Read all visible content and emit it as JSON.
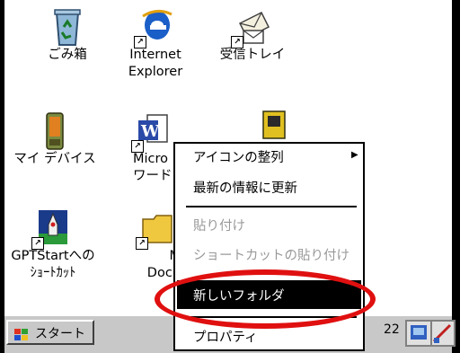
{
  "desktop": {
    "icons": [
      {
        "label1": "ごみ箱",
        "label2": "",
        "icon": "recycle-bin-icon"
      },
      {
        "label1": "Internet",
        "label2": "Explorer",
        "icon": "internet-explorer-icon"
      },
      {
        "label1": "受信トレイ",
        "label2": "",
        "icon": "inbox-icon"
      },
      {
        "label1": "マイ デバイス",
        "label2": "",
        "icon": "my-device-icon"
      },
      {
        "label1": "Micro",
        "label2": "ワード",
        "icon": "word-icon"
      },
      {
        "label1": "GPTStartへの",
        "label2": "ｼｮｰﾄｶｯﾄ",
        "icon": "gptstart-shortcut-icon"
      },
      {
        "label1": "M",
        "label2": "Docu",
        "icon": "my-documents-icon"
      }
    ]
  },
  "context_menu": {
    "items": [
      {
        "label": "アイコンの整列",
        "enabled": true,
        "submenu": true
      },
      {
        "label": "最新の情報に更新",
        "enabled": true
      },
      {
        "label": "貼り付け",
        "enabled": false
      },
      {
        "label": "ショートカットの貼り付け",
        "enabled": false
      },
      {
        "label": "新しいフォルダ",
        "enabled": true,
        "highlighted": true
      },
      {
        "label": "プロパティ",
        "enabled": true
      }
    ],
    "submenu_arrow": "▶"
  },
  "taskbar": {
    "start_label": "スタート",
    "clock": "22"
  },
  "annotation": {
    "ring_color": "#e01010"
  }
}
